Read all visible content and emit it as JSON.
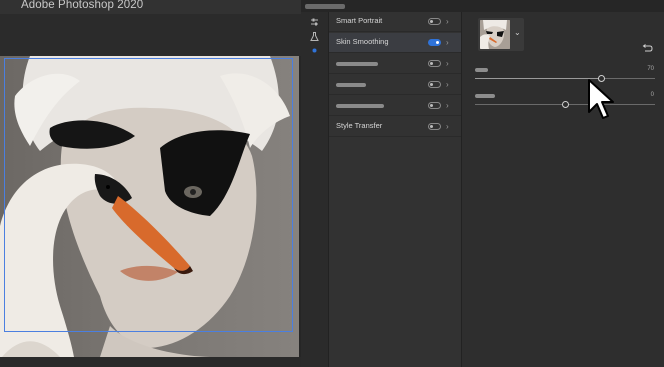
{
  "app": {
    "title": "Adobe Photoshop 2020"
  },
  "colors": {
    "accent": "#2f73d9",
    "selection": "#4b7fe0",
    "panel_bg": "#323232",
    "canvas_bg": "#262626"
  },
  "icon_column": {
    "icons": [
      "sliders-icon",
      "flask-icon",
      "neural-filters-icon"
    ]
  },
  "filters": [
    {
      "label": "Smart Portrait",
      "enabled": false,
      "selected": false
    },
    {
      "label": "Skin Smoothing",
      "enabled": true,
      "selected": true
    },
    {
      "label": "",
      "enabled": false,
      "selected": false
    },
    {
      "label": "",
      "enabled": false,
      "selected": false
    },
    {
      "label": "",
      "enabled": false,
      "selected": false
    },
    {
      "label": "Style Transfer",
      "enabled": false,
      "selected": false
    }
  ],
  "settings": {
    "reference_image": "portrait-thumbnail",
    "reset_icon": "reset-icon",
    "params": [
      {
        "label": "",
        "value": "70",
        "level": 0.7
      },
      {
        "label": "",
        "value": "0",
        "level": 0.5
      }
    ]
  }
}
